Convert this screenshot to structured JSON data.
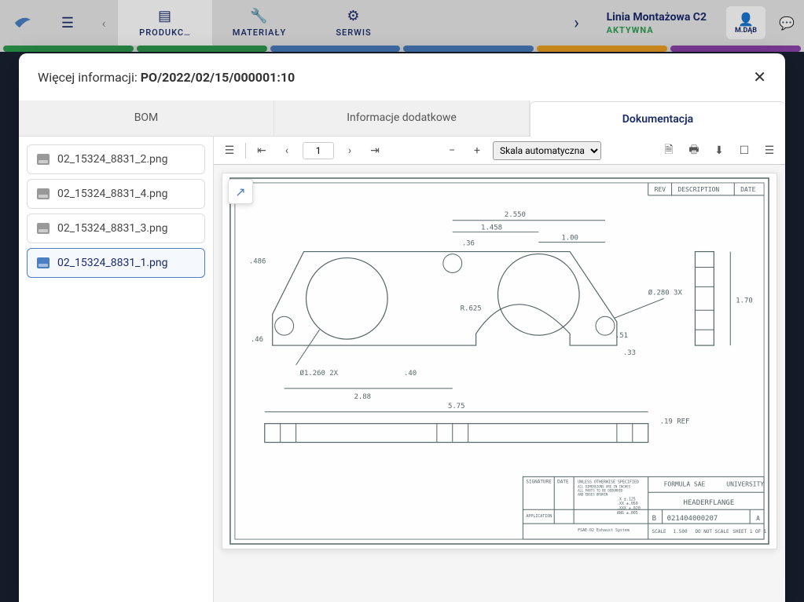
{
  "topbar": {
    "tabs": [
      {
        "label": "PRODUKC…"
      },
      {
        "label": "MATERIAŁY"
      },
      {
        "label": "SERWIS"
      }
    ],
    "line_name": "Linia Montażowa C2",
    "line_status": "AKTYWNA",
    "user": "M.DĄB"
  },
  "modal": {
    "title_prefix": "Więcej informacji: ",
    "title_bold": "PO/2022/02/15/000001:10",
    "tabs": [
      {
        "label": "BOM"
      },
      {
        "label": "Informacje dodatkowe"
      },
      {
        "label": "Dokumentacja"
      }
    ]
  },
  "files": [
    {
      "name": "02_15324_8831_2.png"
    },
    {
      "name": "02_15324_8831_4.png"
    },
    {
      "name": "02_15324_8831_3.png"
    },
    {
      "name": "02_15324_8831_1.png"
    }
  ],
  "toolbar": {
    "page": "1",
    "zoom_select": "Skala automatyczna"
  },
  "drawing": {
    "title_block": {
      "rev": "REV",
      "description": "DESCRIPTION",
      "date": "DATE",
      "signature": "SIGNATURE",
      "tolerances_heading": "UNLESS OTHERWISE SPECIFIED",
      "tol_lines": [
        "ALL DIMENSIONS ARE IN INCHES",
        "ALL PARTS TO BE DEBURRED",
        "AND EDGES BROKEN"
      ],
      "tol_values": [
        ".X ±.125",
        ".XX ±.050",
        ".XXX ±.020",
        "ANG ±.005"
      ],
      "application": "APPLICATION",
      "material_note": "FSAE-02 Exhaust System",
      "org": "FORMULA SAE",
      "org_right": "UNIVERSITY",
      "part": "HEADERFLANGE",
      "drawing_no": "021404000207",
      "rev_letter": "B",
      "rev_a": "A",
      "scale_label": "SCALE",
      "scale_value": "1.500",
      "do_not_scale": "DO NOT SCALE",
      "sheet": "SHEET 1 OF 1"
    },
    "dimensions": {
      "d_2550": "2.550",
      "d_1458": "1.458",
      "d_36": ".36",
      "d_100": "1.00",
      "d_486": ".486",
      "d_46": ".46",
      "d_r625": "R.625",
      "d_51": ".51",
      "d_33": ".33",
      "d_phi280": "Ø.280 3X",
      "d_phi1260": "Ø1.260 2X",
      "d_40": ".40",
      "d_288": "2.88",
      "d_575": "5.75",
      "d_19ref": ".19 REF",
      "d_170": "1.70"
    }
  }
}
